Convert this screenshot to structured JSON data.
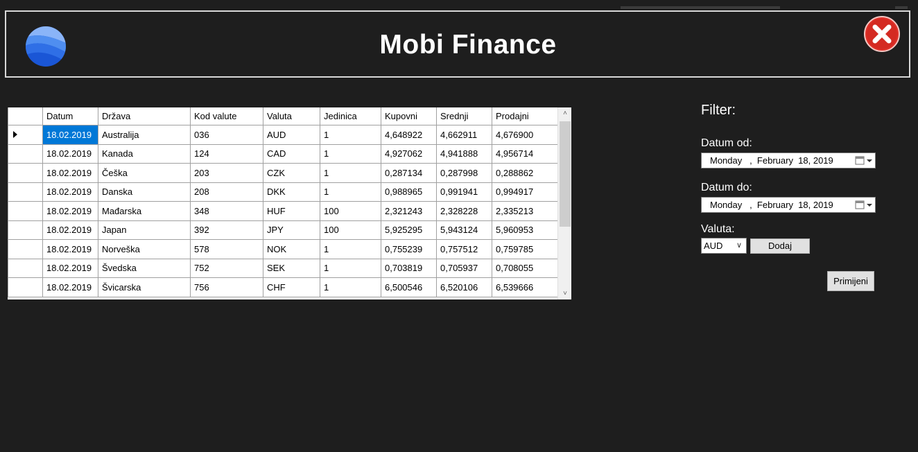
{
  "header": {
    "title": "Mobi Finance"
  },
  "grid": {
    "columns": [
      "Datum",
      "Država",
      "Kod valute",
      "Valuta",
      "Jedinica",
      "Kupovni",
      "Srednji",
      "Prodajni"
    ],
    "rows": [
      [
        "18.02.2019",
        "Australija",
        "036",
        "AUD",
        "1",
        "4,648922",
        "4,662911",
        "4,676900"
      ],
      [
        "18.02.2019",
        "Kanada",
        "124",
        "CAD",
        "1",
        "4,927062",
        "4,941888",
        "4,956714"
      ],
      [
        "18.02.2019",
        "Češka",
        "203",
        "CZK",
        "1",
        "0,287134",
        "0,287998",
        "0,288862"
      ],
      [
        "18.02.2019",
        "Danska",
        "208",
        "DKK",
        "1",
        "0,988965",
        "0,991941",
        "0,994917"
      ],
      [
        "18.02.2019",
        "Mađarska",
        "348",
        "HUF",
        "100",
        "2,321243",
        "2,328228",
        "2,335213"
      ],
      [
        "18.02.2019",
        "Japan",
        "392",
        "JPY",
        "100",
        "5,925295",
        "5,943124",
        "5,960953"
      ],
      [
        "18.02.2019",
        "Norveška",
        "578",
        "NOK",
        "1",
        "0,755239",
        "0,757512",
        "0,759785"
      ],
      [
        "18.02.2019",
        "Švedska",
        "752",
        "SEK",
        "1",
        "0,703819",
        "0,705937",
        "0,708055"
      ],
      [
        "18.02.2019",
        "Švicarska",
        "756",
        "CHF",
        "1",
        "6,500546",
        "6,520106",
        "6,539666"
      ]
    ]
  },
  "filter": {
    "title": "Filter:",
    "datum_od_label": "Datum od:",
    "datum_od_value": "Monday   ,  February  18, 2019",
    "datum_do_label": "Datum do:",
    "datum_do_value": "Monday   ,  February  18, 2019",
    "valuta_label": "Valuta:",
    "valuta_value": "AUD",
    "dodaj_label": "Dodaj",
    "primijeni_label": "Primijeni"
  },
  "colors": {
    "background": "#1e1e1e",
    "selection": "#0078d7",
    "close_red": "#e0322a"
  }
}
